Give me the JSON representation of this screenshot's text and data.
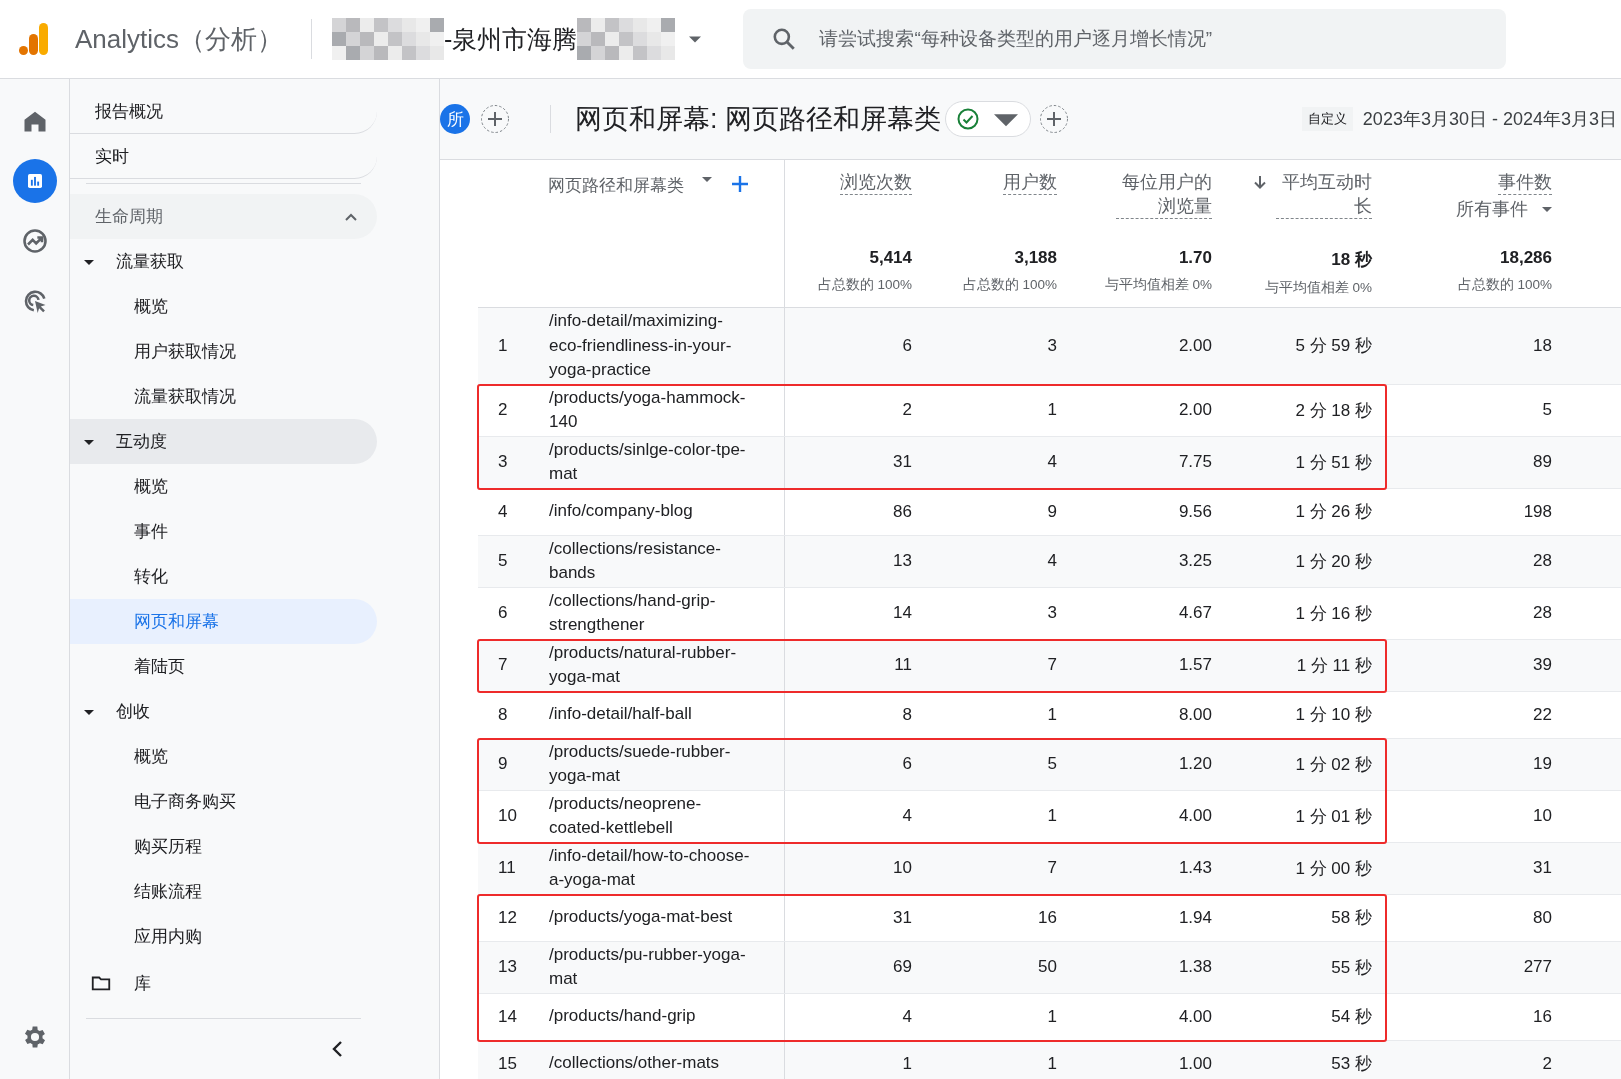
{
  "app": {
    "name": "Analytics（分析）"
  },
  "property": {
    "name": "-泉州市海腾",
    "redacted": true
  },
  "search": {
    "placeholder": "请尝试搜索“每种设备类型的用户逐月增长情况”"
  },
  "rail": [
    {
      "kind": "home",
      "selected": false
    },
    {
      "kind": "reports",
      "selected": true
    },
    {
      "kind": "explore",
      "selected": false
    },
    {
      "kind": "advertising",
      "selected": false
    }
  ],
  "nav": {
    "top_items": [
      {
        "label": "报告概况",
        "selected": false
      },
      {
        "label": "实时",
        "selected": false
      }
    ],
    "section": {
      "label": "生命周期",
      "expanded": true,
      "groups": [
        {
          "label": "流量获取",
          "expanded": true,
          "highlighted": false,
          "children": [
            {
              "label": "概览",
              "selected": false
            },
            {
              "label": "用户获取情况",
              "selected": false
            },
            {
              "label": "流量获取情况",
              "selected": false
            }
          ]
        },
        {
          "label": "互动度",
          "expanded": true,
          "highlighted": true,
          "children": [
            {
              "label": "概览",
              "selected": false
            },
            {
              "label": "事件",
              "selected": false
            },
            {
              "label": "转化",
              "selected": false
            },
            {
              "label": "网页和屏幕",
              "selected": true
            },
            {
              "label": "着陆页",
              "selected": false
            }
          ]
        },
        {
          "label": "创收",
          "expanded": true,
          "highlighted": false,
          "children": [
            {
              "label": "概览",
              "selected": false
            },
            {
              "label": "电子商务购买",
              "selected": false
            },
            {
              "label": "购买历程",
              "selected": false
            },
            {
              "label": "结账流程",
              "selected": false
            },
            {
              "label": "应用内购",
              "selected": false
            }
          ]
        }
      ]
    },
    "library": {
      "label": "库"
    }
  },
  "report": {
    "comparison_badge": "所",
    "title": "网页和屏幕: 网页路径和屏幕类",
    "date_chip": "自定义",
    "date_range": "2023年3月30日 - 2024年3月3日"
  },
  "table": {
    "dimension": "网页路径和屏幕类",
    "columns": [
      {
        "label": "浏览次数",
        "sorted": false
      },
      {
        "label": "用户数",
        "sorted": false
      },
      {
        "label": "每位用户的浏览量",
        "sorted": false
      },
      {
        "label": "平均互动时长",
        "sorted": true
      },
      {
        "label": "事件数",
        "sub": "所有事件",
        "sorted": false
      }
    ],
    "totals": [
      {
        "value": "5,414",
        "note": "占总数的 100%"
      },
      {
        "value": "3,188",
        "note": "占总数的 100%"
      },
      {
        "value": "1.70",
        "note": "与平均值相差 0%"
      },
      {
        "value": "18 秒",
        "note": "与平均值相差 0%"
      },
      {
        "value": "18,286",
        "note": "占总数的 100%"
      }
    ],
    "rows": [
      {
        "index": "1",
        "path": "/info-detail/maximizing-eco-friendliness-in-your-yoga-practice",
        "values": [
          "6",
          "3",
          "2.00",
          "5 分 59 秒",
          "18"
        ],
        "highlighted": false
      },
      {
        "index": "2",
        "path": "/products/yoga-hammock-140",
        "values": [
          "2",
          "1",
          "2.00",
          "2 分 18 秒",
          "5"
        ],
        "highlighted": true
      },
      {
        "index": "3",
        "path": "/products/sinlge-color-tpe-mat",
        "values": [
          "31",
          "4",
          "7.75",
          "1 分 51 秒",
          "89"
        ],
        "highlighted": true
      },
      {
        "index": "4",
        "path": "/info/company-blog",
        "values": [
          "86",
          "9",
          "9.56",
          "1 分 26 秒",
          "198"
        ],
        "highlighted": false
      },
      {
        "index": "5",
        "path": "/collections/resistance-bands",
        "values": [
          "13",
          "4",
          "3.25",
          "1 分 20 秒",
          "28"
        ],
        "highlighted": false
      },
      {
        "index": "6",
        "path": "/collections/hand-grip-strengthener",
        "values": [
          "14",
          "3",
          "4.67",
          "1 分 16 秒",
          "28"
        ],
        "highlighted": false
      },
      {
        "index": "7",
        "path": "/products/natural-rubber-yoga-mat",
        "values": [
          "11",
          "7",
          "1.57",
          "1 分 11 秒",
          "39"
        ],
        "highlighted": true
      },
      {
        "index": "8",
        "path": "/info-detail/half-ball",
        "values": [
          "8",
          "1",
          "8.00",
          "1 分 10 秒",
          "22"
        ],
        "highlighted": false
      },
      {
        "index": "9",
        "path": "/products/suede-rubber-yoga-mat",
        "values": [
          "6",
          "5",
          "1.20",
          "1 分 02 秒",
          "19"
        ],
        "highlighted": true
      },
      {
        "index": "10",
        "path": "/products/neoprene-coated-kettlebell",
        "values": [
          "4",
          "1",
          "4.00",
          "1 分 01 秒",
          "10"
        ],
        "highlighted": true
      },
      {
        "index": "11",
        "path": "/info-detail/how-to-choose-a-yoga-mat",
        "values": [
          "10",
          "7",
          "1.43",
          "1 分 00 秒",
          "31"
        ],
        "highlighted": false
      },
      {
        "index": "12",
        "path": "/products/yoga-mat-best",
        "values": [
          "31",
          "16",
          "1.94",
          "58 秒",
          "80"
        ],
        "highlighted": true
      },
      {
        "index": "13",
        "path": "/products/pu-rubber-yoga-mat",
        "values": [
          "69",
          "50",
          "1.38",
          "55 秒",
          "277"
        ],
        "highlighted": true
      },
      {
        "index": "14",
        "path": "/products/hand-grip",
        "values": [
          "4",
          "1",
          "4.00",
          "54 秒",
          "16"
        ],
        "highlighted": true
      },
      {
        "index": "15",
        "path": "/collections/other-mats",
        "values": [
          "1",
          "1",
          "1.00",
          "53 秒",
          "2"
        ],
        "highlighted": false
      }
    ]
  }
}
